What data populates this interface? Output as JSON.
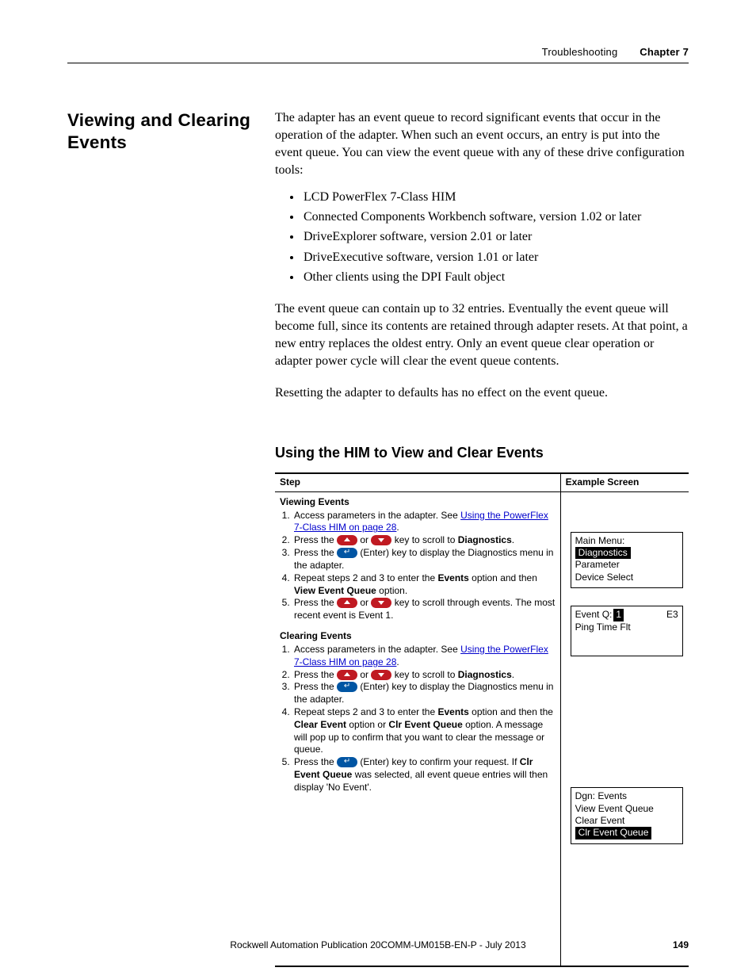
{
  "header": {
    "section": "Troubleshooting",
    "chapter": "Chapter 7"
  },
  "heading": "Viewing and Clearing Events",
  "intro": "The adapter has an event queue to record significant events that occur in the operation of the adapter. When such an event occurs, an entry is put into the event queue. You can view the event queue with any of these drive configuration tools:",
  "bullets": [
    "LCD PowerFlex 7-Class HIM",
    "Connected Components Workbench software, version 1.02 or later",
    "DriveExplorer software, version 2.01 or later",
    "DriveExecutive software, version 1.01 or later",
    "Other clients using the DPI Fault object"
  ],
  "para2": "The event queue can contain up to 32 entries. Eventually the event queue will become full, since its contents are retained through adapter resets. At that point, a new entry replaces the oldest entry. Only an event queue clear operation or adapter power cycle will clear the event queue contents.",
  "para3": "Resetting the adapter to defaults has no effect on the event queue.",
  "subheading": "Using the HIM to View and Clear Events",
  "table": {
    "col1": "Step",
    "col2": "Example Screen",
    "viewing": {
      "title": "Viewing Events",
      "s1a": "Access parameters in the adapter. See ",
      "s1l": "Using the PowerFlex 7-Class HIM on page 28",
      "s1b": ".",
      "s2a": "Press the ",
      "s2b": " or ",
      "s2c": " key to scroll to ",
      "s2d": "Diagnostics",
      "s2e": ".",
      "s3a": "Press the ",
      "s3b": " (Enter) key to display the Diagnostics menu in the adapter.",
      "s4a": "Repeat steps 2 and 3 to enter the ",
      "s4b": "Events",
      "s4c": " option and then ",
      "s4d": "View Event Queue",
      "s4e": " option.",
      "s5a": "Press the ",
      "s5b": " or ",
      "s5c": " key to scroll through events. The most recent event is Event 1."
    },
    "clearing": {
      "title": "Clearing Events",
      "s1a": "Access parameters in the adapter. See ",
      "s1l": "Using the PowerFlex 7-Class HIM on page 28",
      "s1b": ".",
      "s2a": "Press the ",
      "s2b": " or ",
      "s2c": " key to scroll to ",
      "s2d": "Diagnostics",
      "s2e": ".",
      "s3a": "Press the ",
      "s3b": " (Enter) key to display the Diagnostics menu in the adapter.",
      "s4a": "Repeat steps 2 and 3 to enter the ",
      "s4b": "Events",
      "s4c": " option and then the ",
      "s4d": "Clear Event",
      "s4e": " option or ",
      "s4f": "Clr Event Queue",
      "s4g": " option. A message will pop up to confirm that you want to clear the message or queue.",
      "s5a": "Press the ",
      "s5b": " (Enter) key to confirm your request. If ",
      "s5c": "Clr Event Queue",
      "s5d": " was selected, all event queue entries will then display 'No Event'."
    },
    "screen1": {
      "l1": "Main Menu:",
      "l2": "Diagnostics",
      "l3": "Parameter",
      "l4": "Device Select"
    },
    "screen2": {
      "l1a": "Event Q:",
      "l1b": "1",
      "l1c": "E3",
      "l2": "Ping Time Flt"
    },
    "screen3": {
      "l1": "Dgn: Events",
      "l2": "View Event Queue",
      "l3": "Clear Event",
      "l4": "Clr Event Queue"
    }
  },
  "footer": {
    "pub": "Rockwell Automation Publication  20COMM-UM015B-EN-P - July 2013",
    "page": "149"
  }
}
